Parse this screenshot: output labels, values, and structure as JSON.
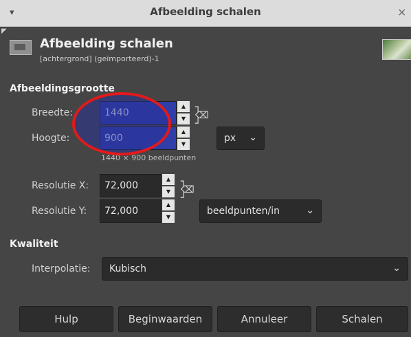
{
  "window": {
    "title": "Afbeelding schalen",
    "menu_icon": "chevron-down-icon",
    "close_icon": "close-icon",
    "close_glyph": "×",
    "menu_glyph": "▾"
  },
  "header": {
    "title": "Afbeelding schalen",
    "subtitle": "[achtergrond] (geïmporteerd)-1"
  },
  "image_size": {
    "section_label": "Afbeeldingsgrootte",
    "width_label": "Breedte:",
    "width_value": "1440",
    "height_label": "Hoogte:",
    "height_value": "900",
    "unit": "px",
    "pixel_hint": "1440 × 900 beeldpunten",
    "res_x_label": "Resolutie X:",
    "res_x_value": "72,000",
    "res_y_label": "Resolutie Y:",
    "res_y_value": "72,000",
    "res_unit": "beeldpunten/in"
  },
  "quality": {
    "section_label": "Kwaliteit",
    "interpolation_label": "Interpolatie:",
    "interpolation_value": "Kubisch"
  },
  "buttons": {
    "help": "Hulp",
    "reset": "Beginwaarden",
    "cancel": "Annuleer",
    "scale": "Schalen"
  },
  "colors": {
    "accent_selection": "#2f3ea8",
    "highlight_ring": "#e21a1a"
  }
}
